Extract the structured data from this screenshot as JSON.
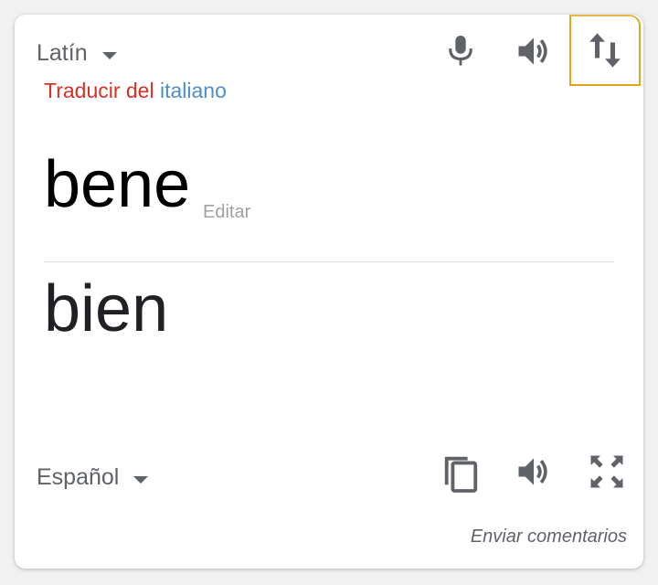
{
  "colors": {
    "accent_red": "#d93025",
    "link_blue": "#4e8ecb",
    "icon_gray": "#5f6368",
    "focus_border": "#e0a615"
  },
  "source": {
    "language": "Latín",
    "detected_prefix": "Traducir del",
    "detected_language": "italiano",
    "text": "bene",
    "edit_label": "Editar",
    "icons": [
      "mic-icon",
      "speaker-icon",
      "swap-icon"
    ]
  },
  "target": {
    "language": "Español",
    "text": "bien",
    "icons": [
      "copy-icon",
      "speaker-icon",
      "fullscreen-icon"
    ]
  },
  "footer": {
    "feedback_label": "Enviar comentarios"
  }
}
